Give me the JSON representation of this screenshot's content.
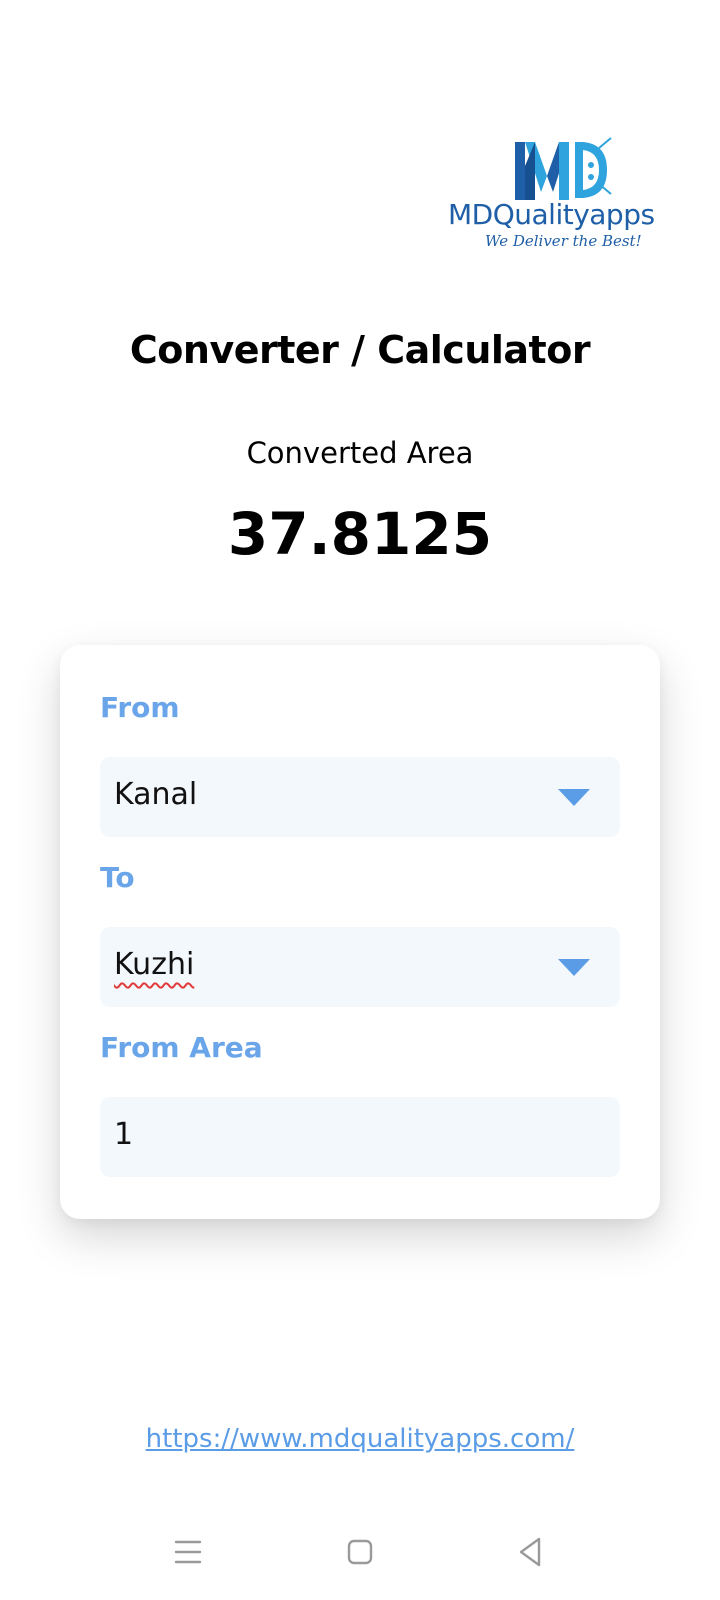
{
  "logo": {
    "brand_name": "MDQualityapps",
    "tagline": "We Deliver the Best!",
    "colors": {
      "primary": "#1f5fa8",
      "accent": "#2ea3dd"
    }
  },
  "header": {
    "title": "Converter / Calculator"
  },
  "result": {
    "label": "Converted Area",
    "value": "37.8125"
  },
  "form": {
    "from_label": "From",
    "from_value": "Kanal",
    "to_label": "To",
    "to_value": "Kuzhi",
    "area_label": "From Area",
    "area_value": "1"
  },
  "footer": {
    "link_text": "https://www.mdqualityapps.com/"
  },
  "nav": {
    "icons": [
      "menu-icon",
      "home-icon",
      "back-icon"
    ]
  },
  "colors": {
    "label_blue": "#6aa5e9",
    "field_bg": "#f3f8fd",
    "dropdown_arrow": "#5b9ce6",
    "link": "#5b9ce6"
  }
}
